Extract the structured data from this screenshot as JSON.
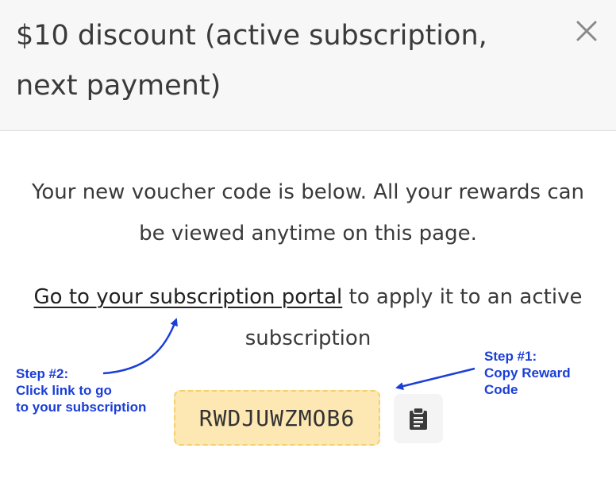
{
  "dialog": {
    "title": "$10 discount (active subscription, next payment)",
    "close_icon": "close-icon"
  },
  "content": {
    "intro": "Your new voucher code is below. All your rewards can be viewed anytime on this page.",
    "portal_link": "Go to your subscription portal",
    "apply_suffix": " to apply it to an active subscription"
  },
  "voucher": {
    "code": "RWDJUWZMOB6",
    "copy_icon": "clipboard-icon"
  },
  "annotations": {
    "step1": {
      "lines": [
        "Step #1:",
        "Copy Reward",
        "Code"
      ]
    },
    "step2": {
      "lines": [
        "Step #2:",
        "Click link to go",
        "to your subscription"
      ]
    }
  },
  "colors": {
    "header_bg": "#f7f7f7",
    "code_bg": "#fde8b4",
    "code_border": "#f3cf6d",
    "annotation": "#1a3ed8",
    "copy_button_bg": "#f4f4f4"
  }
}
